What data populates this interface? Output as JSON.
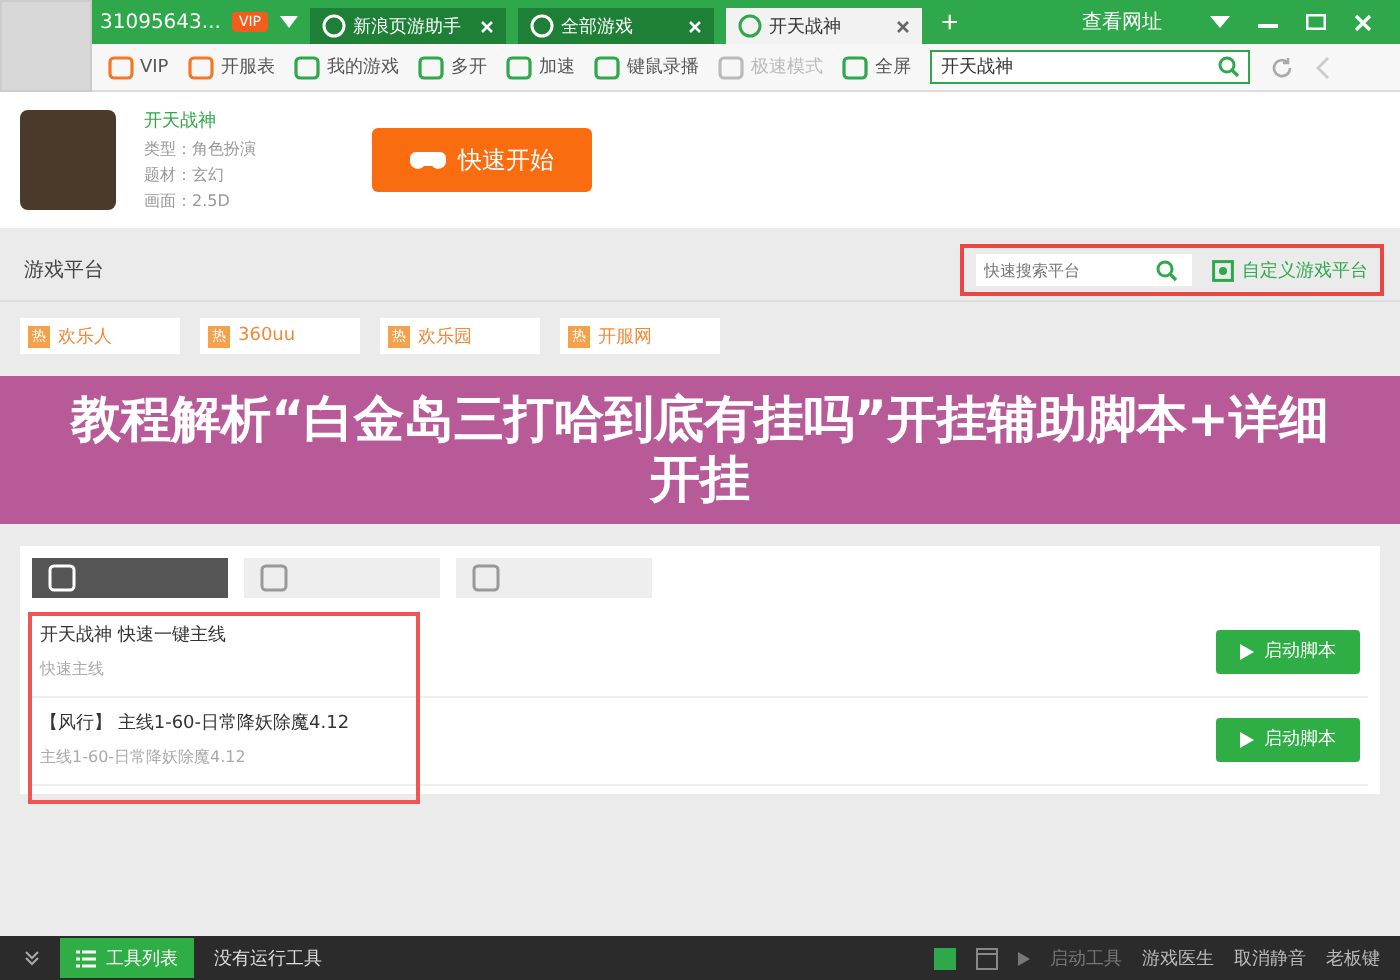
{
  "title_bar": {
    "account": "31095643...",
    "vip_badge": "VIP",
    "tabs": [
      {
        "label": "新浪页游助手",
        "selected": false
      },
      {
        "label": "全部游戏",
        "selected": false
      },
      {
        "label": "开天战神",
        "selected": true
      }
    ],
    "new_tab": "+",
    "address_button": "查看网址"
  },
  "toolbar": {
    "items": [
      {
        "label": "VIP"
      },
      {
        "label": "开服表"
      },
      {
        "label": "我的游戏"
      },
      {
        "label": "多开"
      },
      {
        "label": "加速"
      },
      {
        "label": "键鼠录播"
      },
      {
        "label": "极速模式",
        "disabled": true
      },
      {
        "label": "全屏"
      }
    ],
    "search_value": "开天战神"
  },
  "game": {
    "name": "开天战神",
    "details": [
      "类型：角色扮演",
      "题材：玄幻",
      "画面：2.5D"
    ],
    "start_button": "快速开始"
  },
  "platforms": {
    "title": "游戏平台",
    "search_placeholder": "快速搜索平台",
    "custom_button": "自定义游戏平台",
    "items": [
      {
        "badge": "热",
        "name": "欢乐人"
      },
      {
        "badge": "热",
        "name": "360uu"
      },
      {
        "badge": "热",
        "name": "欢乐园"
      },
      {
        "badge": "热",
        "name": "开服网"
      }
    ]
  },
  "banner": {
    "text": "教程解析“白金岛三打哈到底有挂吗”开挂辅助脚本+详细开挂"
  },
  "scripts": {
    "tabs": [
      {
        "selected": true
      },
      {
        "selected": false
      },
      {
        "selected": false
      }
    ],
    "rows": [
      {
        "title": "开天战神 快速一键主线",
        "subtitle": "快速主线",
        "button": "启动脚本"
      },
      {
        "title": "【风行】 主线1-60-日常降妖除魔4.12",
        "subtitle": "主线1-60-日常降妖除魔4.12",
        "button": "启动脚本"
      }
    ]
  },
  "bottom_bar": {
    "tools_button": "工具列表",
    "status": "没有运行工具",
    "start_tool": "启动工具",
    "doctor": "游戏医生",
    "mute": "取消静音",
    "boss_key": "老板键"
  }
}
